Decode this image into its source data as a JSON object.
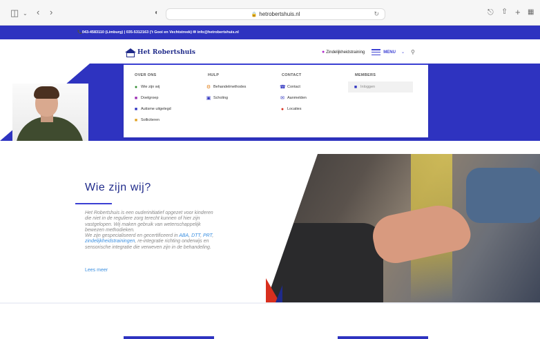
{
  "browser": {
    "url": "hetrobertshuis.nl",
    "icons": [
      "sidebar-icon",
      "chevron-down-icon",
      "back-icon",
      "forward-icon",
      "shield-icon",
      "lock-icon",
      "reload-icon",
      "download-icon",
      "share-icon",
      "new-tab-icon",
      "tab-overview-icon"
    ]
  },
  "topbar": {
    "contact_line": "📞043-4583110 (Limburg) | 035-5312163 ('t Gooi en Vechtstreek)  ✉ info@hetrobertshuis.nl"
  },
  "header": {
    "logo_text": "Het Robertshuis",
    "training_link": "Zindelijkheidstraining",
    "menu_label": "MENU"
  },
  "mega_menu": {
    "columns": [
      {
        "heading": "OVER ONS",
        "items": [
          {
            "label": "Wie zijn wij",
            "icon": "people-icon",
            "color": "#2e8b2e"
          },
          {
            "label": "Doelgroep",
            "icon": "target-icon",
            "color": "#9b2bb3"
          },
          {
            "label": "Autisme uitgelegd",
            "icon": "book-icon",
            "color": "#2e33c0"
          },
          {
            "label": "Solliciteren",
            "icon": "briefcase-icon",
            "color": "#e0a020"
          }
        ]
      },
      {
        "heading": "HULP",
        "items": [
          {
            "label": "Behandelmethodes",
            "icon": "gear-icon",
            "color": "#e07a10"
          },
          {
            "label": "Scholing",
            "icon": "monitor-icon",
            "color": "#2e33c0"
          }
        ]
      },
      {
        "heading": "CONTACT",
        "items": [
          {
            "label": "Contact",
            "icon": "phone-icon",
            "color": "#2e33c0"
          },
          {
            "label": "Aanmelden",
            "icon": "mail-icon",
            "color": "#2e33c0"
          },
          {
            "label": "Locaties",
            "icon": "pin-icon",
            "color": "#d82f1e"
          }
        ]
      },
      {
        "heading": "MEMBERS",
        "items": [
          {
            "label": "Inloggen",
            "icon": "lock-icon",
            "color": "#2e33c0"
          }
        ]
      }
    ]
  },
  "intro": {
    "title": "Wie zijn wij?",
    "paragraph_1": "Het Robertshuis is een ouderinitiatief opgezet voor kinderen die niet in de reguliere zorg terecht kunnen of hier zijn vastgelopen. Wij maken gebruik van wetenschappelijk bewezen methodieken.",
    "p2_prefix": "We zijn gespecialiseerd en gecertificeerd in ",
    "link_aba": "ABA",
    "sep_1": ", ",
    "link_dtt": "DTT",
    "sep_2": ", ",
    "link_prt": "PRT",
    "sep_3": ", ",
    "link_zind": "zindelijkheidstrainingen",
    "p2_suffix": ", re-integratie richting onderwijs en sensorische integratie die verweven zijn in de behandeling.",
    "read_more": "Lees meer"
  },
  "colors": {
    "brand_blue": "#2e33c0",
    "dark_blue": "#1f2a8a",
    "link_blue": "#3a8fe0",
    "accent_red": "#d82f1e"
  }
}
